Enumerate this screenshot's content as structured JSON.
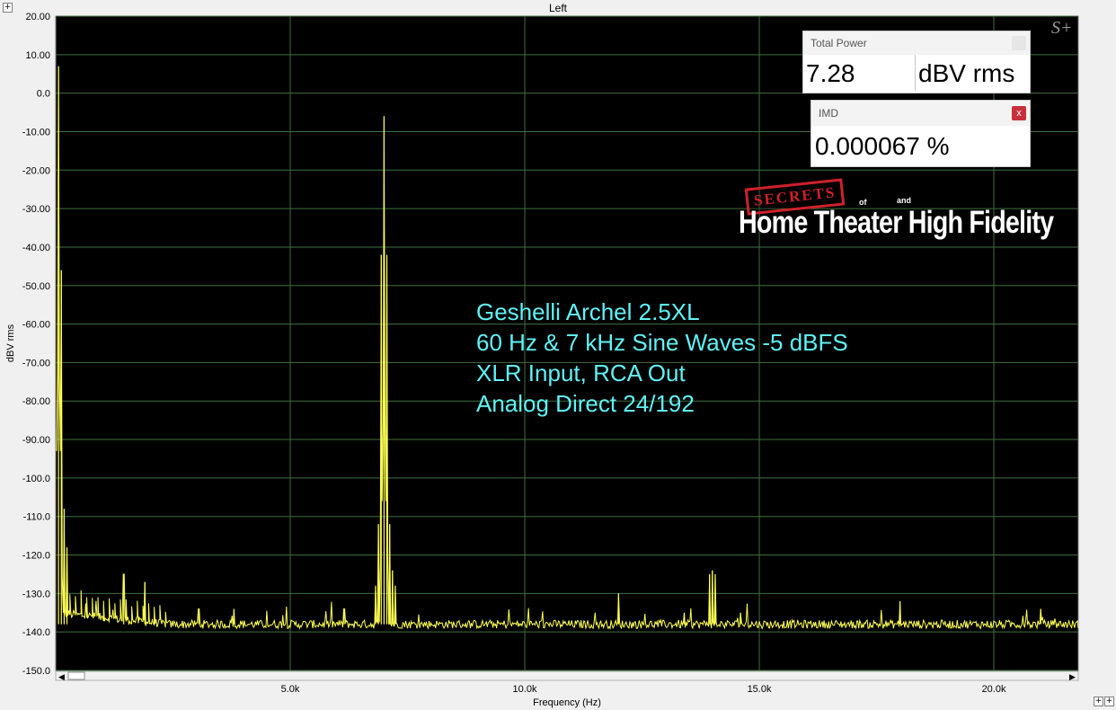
{
  "panel": {
    "title": "Left",
    "expand_glyph": "+"
  },
  "chart_data": {
    "type": "line",
    "xlabel": "Frequency (Hz)",
    "ylabel": "dBV rms",
    "xlim": [
      0,
      21800
    ],
    "ylim": [
      -150,
      20
    ],
    "x_ticks": [
      5000,
      10000,
      15000,
      20000
    ],
    "x_tick_labels": [
      "5.0k",
      "10.0k",
      "15.0k",
      "20.0k"
    ],
    "y_ticks": [
      20,
      10,
      0,
      -10,
      -20,
      -30,
      -40,
      -50,
      -60,
      -70,
      -80,
      -90,
      -100,
      -110,
      -120,
      -130,
      -140,
      -150
    ],
    "y_tick_labels": [
      "20.00",
      "10.00",
      "0.0",
      "-10.00",
      "-20.00",
      "-30.00",
      "-40.00",
      "-50.00",
      "-60.00",
      "-70.00",
      "-80.00",
      "-90.00",
      "-100.0",
      "-110.0",
      "-120.0",
      "-130.0",
      "-140.0",
      "-150.0"
    ],
    "grid": true,
    "colors": {
      "background": "#000000",
      "grid": "#3f6f3f",
      "trace": "#ffff55",
      "annotation": "#5ff3f7"
    },
    "series": [
      {
        "noise_floor": -138,
        "peaks": [
          {
            "x": 60,
            "y": 7
          },
          {
            "x": 120,
            "y": -46
          },
          {
            "x": 180,
            "y": -108
          },
          {
            "x": 240,
            "y": -118
          },
          {
            "x": 7000,
            "y": -6
          },
          {
            "x": 6940,
            "y": -42
          },
          {
            "x": 7060,
            "y": -42
          },
          {
            "x": 6880,
            "y": -112
          },
          {
            "x": 7120,
            "y": -112
          },
          {
            "x": 6820,
            "y": -128
          },
          {
            "x": 7180,
            "y": -124
          },
          {
            "x": 7240,
            "y": -128
          },
          {
            "x": 12000,
            "y": -130
          },
          {
            "x": 13940,
            "y": -125
          },
          {
            "x": 14000,
            "y": -124
          },
          {
            "x": 14060,
            "y": -125
          },
          {
            "x": 18000,
            "y": -132
          },
          {
            "x": 21000,
            "y": -134
          },
          {
            "x": 1450,
            "y": -125
          },
          {
            "x": 1900,
            "y": -127
          },
          {
            "x": 3050,
            "y": -134
          },
          {
            "x": 3800,
            "y": -134
          },
          {
            "x": 6150,
            "y": -134
          },
          {
            "x": 13400,
            "y": -135
          },
          {
            "x": 14600,
            "y": -135
          }
        ]
      }
    ]
  },
  "annotation": {
    "lines": [
      "Geshelli Archel 2.5XL",
      "60 Hz & 7 kHz Sine Waves -5 dBFS",
      "XLR Input, RCA Out",
      "Analog Direct 24/192"
    ]
  },
  "meters": {
    "total_power": {
      "title": "Total Power",
      "value": "7.28",
      "unit": "dBV rms"
    },
    "imd": {
      "title": "IMD",
      "value": "0.000067 %",
      "close": "x"
    }
  },
  "logo": {
    "secrets": "SECRETS",
    "of": "of",
    "and": "and",
    "main": "Home Theater High Fidelity",
    "badge": "S+"
  }
}
